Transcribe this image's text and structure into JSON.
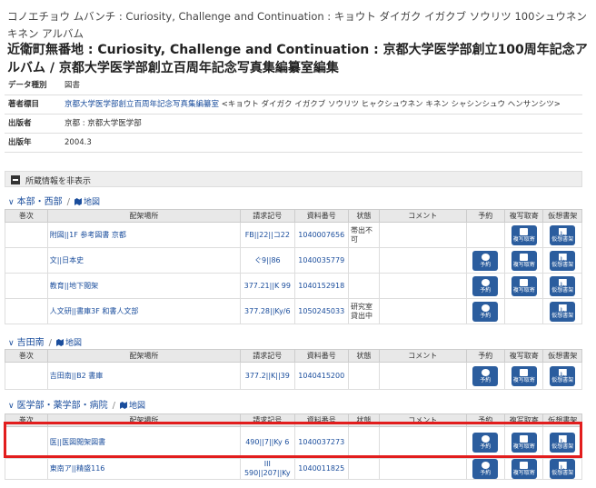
{
  "kana_title": "コノエチョウ ムバンチ : Curiosity, Challenge and Continuation : キョウト ダイガク イガクブ ソウリツ 100シュウネン キネン アルバム",
  "title": "近衛町無番地 : Curiosity, Challenge and Continuation : 京都大学医学部創立100周年記念アルバム / 京都大学医学部創立百周年記念写真集編纂室編集",
  "meta": [
    {
      "k": "データ種別",
      "v": "図書"
    },
    {
      "k": "著者標目",
      "v": "京都大学医学部創立百周年記念写真集編纂室",
      "v2": " <キョウト ダイガク イガクブ ソウリツ ヒャクシュウネン キネン シャシンシュウ ヘンサンシツ>"
    },
    {
      "k": "出版者",
      "v": "京都 : 京都大学医学部"
    },
    {
      "k": "出版年",
      "v": "2004.3"
    }
  ],
  "holdings_toggle": "所蔵情報を非表示",
  "map_label": "地図",
  "headers": {
    "vol": "巻次",
    "loc": "配架場所",
    "call": "請求記号",
    "id": "資料番号",
    "status": "状態",
    "comment": "コメント",
    "reserve": "予約",
    "copy": "複写取寄",
    "shelf": "仮想書架"
  },
  "btn": {
    "reserve": "予約",
    "copy": "複写取寄",
    "shelf": "仮想書架"
  },
  "groups": [
    {
      "name": "本部・西部",
      "rows": [
        {
          "loc": "附図||1F 参考図書 京都",
          "call": "FB||22||コ22",
          "id": "1040007656",
          "status": "帯出不可",
          "reserve": false,
          "copy": true,
          "shelf": true
        },
        {
          "loc": "文||日本史",
          "call": "ぐ9||86",
          "id": "1040035779",
          "status": "",
          "reserve": true,
          "copy": true,
          "shelf": true
        },
        {
          "loc": "教育||地下閲架",
          "call": "377.21||K 99",
          "id": "1040152918",
          "status": "",
          "reserve": true,
          "copy": true,
          "shelf": true
        },
        {
          "loc": "人文研||書庫3F 和書人文部",
          "call": "377.28||Ky/6",
          "id": "1050245033",
          "status": "研究室貸出中",
          "reserve": true,
          "copy": false,
          "shelf": true
        }
      ]
    },
    {
      "name": "吉田南",
      "rows": [
        {
          "loc": "吉田南||B2 書庫",
          "call": "377.2||K||39",
          "id": "1040415200",
          "status": "",
          "reserve": true,
          "copy": true,
          "shelf": true
        }
      ]
    },
    {
      "name": "医学部・薬学部・病院",
      "rows": [
        {
          "loc": "医||医図閲架図書",
          "call": "490||7||Ky 6",
          "id": "1040037273",
          "status": "",
          "reserve": true,
          "copy": true,
          "shelf": true
        },
        {
          "loc": "東南ア||精盛116",
          "call": "III 590||207||Ky",
          "id": "1040011825",
          "status": "",
          "reserve": true,
          "copy": true,
          "shelf": true
        }
      ]
    }
  ]
}
